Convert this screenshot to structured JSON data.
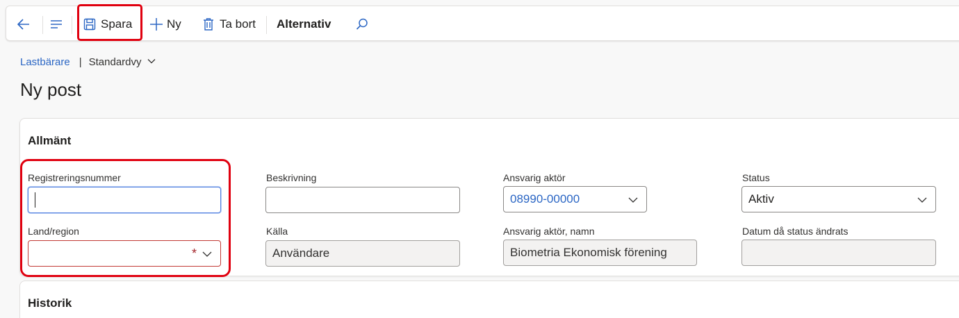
{
  "toolbar": {
    "back_icon": "arrow-left-icon",
    "menu_icon": "hamburger-icon",
    "save_label": "Spara",
    "new_label": "Ny",
    "delete_label": "Ta bort",
    "options_label": "Alternativ",
    "search_icon": "search-icon"
  },
  "breadcrumb": {
    "link": "Lastbärare",
    "separator": "|",
    "view": "Standardvy"
  },
  "page_title": "Ny post",
  "general": {
    "title": "Allmänt",
    "fields": {
      "registration": {
        "label": "Registreringsnummer",
        "value": ""
      },
      "country": {
        "label": "Land/region",
        "value": "",
        "required_mark": "*"
      },
      "description": {
        "label": "Beskrivning",
        "value": ""
      },
      "source": {
        "label": "Källa",
        "value": "Användare"
      },
      "responsible_actor": {
        "label": "Ansvarig aktör",
        "value": "08990-00000"
      },
      "responsible_actor_name": {
        "label": "Ansvarig aktör, namn",
        "value": "Biometria Ekonomisk förening"
      },
      "status": {
        "label": "Status",
        "value": "Aktiv"
      },
      "status_changed_date": {
        "label": "Datum då status ändrats",
        "value": ""
      }
    }
  },
  "history": {
    "title": "Historik"
  },
  "colors": {
    "accent": "#2b66c4",
    "highlight": "#e0000f",
    "error": "#c23934"
  }
}
